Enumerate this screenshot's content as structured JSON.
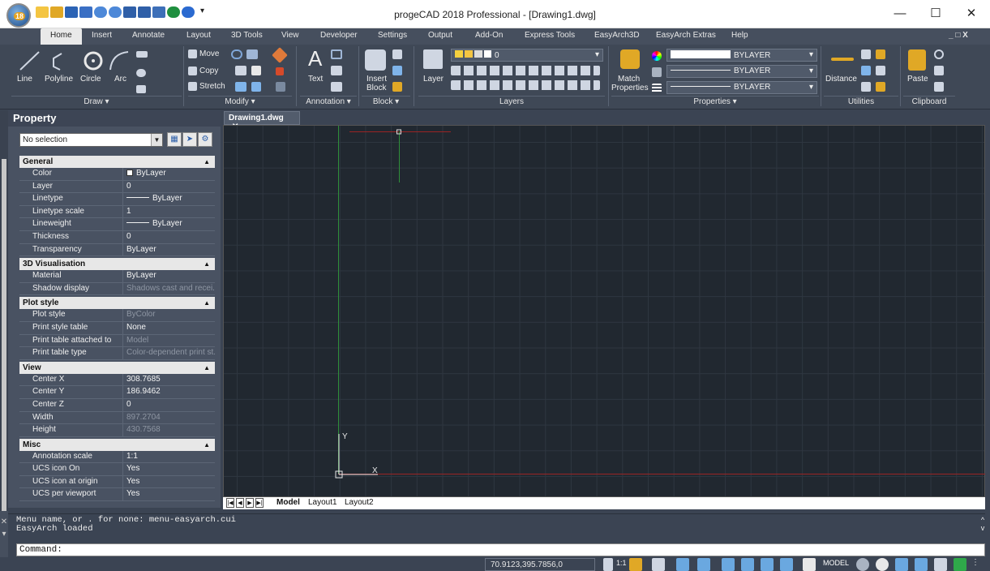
{
  "window": {
    "title": "progeCAD 2018 Professional - [Drawing1.dwg]",
    "app_badge": "18"
  },
  "menu_tabs": [
    "Home",
    "Insert",
    "Annotate",
    "Layout",
    "3D Tools",
    "View",
    "Developer",
    "Settings",
    "Output",
    "Add-On",
    "Express Tools",
    "EasyArch3D",
    "EasyArch Extras",
    "Help"
  ],
  "ribbon": {
    "draw": {
      "line": "Line",
      "polyline": "Polyline",
      "circle": "Circle",
      "arc": "Arc",
      "group": "Draw ▾"
    },
    "modify": {
      "move": "Move",
      "copy": "Copy",
      "stretch": "Stretch",
      "group": "Modify ▾"
    },
    "annotation": {
      "text": "Text",
      "group": "Annotation ▾"
    },
    "block": {
      "insert": "Insert",
      "insert2": "Block",
      "group": "Block ▾"
    },
    "layers": {
      "layer": "Layer",
      "current": "0",
      "group": "Layers"
    },
    "properties": {
      "match": "Match",
      "match2": "Properties",
      "color": "BYLAYER",
      "linetype": "BYLAYER",
      "lineweight": "BYLAYER",
      "group": "Properties ▾"
    },
    "utilities": {
      "distance": "Distance",
      "group": "Utilities"
    },
    "clipboard": {
      "paste": "Paste",
      "group": "Clipboard"
    }
  },
  "property_panel": {
    "title": "Property",
    "selection": "No selection",
    "sections": [
      {
        "name": "General",
        "rows": [
          {
            "key": "Color",
            "value": "ByLayer"
          },
          {
            "key": "Layer",
            "value": "0"
          },
          {
            "key": "Linetype",
            "value": "ByLayer"
          },
          {
            "key": "Linetype scale",
            "value": "1"
          },
          {
            "key": "Lineweight",
            "value": "ByLayer"
          },
          {
            "key": "Thickness",
            "value": "0"
          },
          {
            "key": "Transparency",
            "value": "ByLayer"
          }
        ]
      },
      {
        "name": "3D Visualisation",
        "rows": [
          {
            "key": "Material",
            "value": "ByLayer"
          },
          {
            "key": "Shadow display",
            "value": "Shadows cast and recei..."
          }
        ]
      },
      {
        "name": "Plot style",
        "rows": [
          {
            "key": "Plot style",
            "value": "ByColor"
          },
          {
            "key": "Print style table",
            "value": "None"
          },
          {
            "key": "Print table attached to",
            "value": "Model"
          },
          {
            "key": "Print table type",
            "value": "Color-dependent print st..."
          }
        ]
      },
      {
        "name": "View",
        "rows": [
          {
            "key": "Center X",
            "value": "308.7685"
          },
          {
            "key": "Center Y",
            "value": "186.9462"
          },
          {
            "key": "Center Z",
            "value": "0"
          },
          {
            "key": "Width",
            "value": "897.2704"
          },
          {
            "key": "Height",
            "value": "430.7568"
          }
        ]
      },
      {
        "name": "Misc",
        "rows": [
          {
            "key": "Annotation scale",
            "value": "1:1"
          },
          {
            "key": "UCS icon On",
            "value": "Yes"
          },
          {
            "key": "UCS icon at origin",
            "value": "Yes"
          },
          {
            "key": "UCS per viewport",
            "value": "Yes"
          }
        ]
      }
    ]
  },
  "doc_tab": "Drawing1.dwg",
  "ucs": {
    "x": "X",
    "y": "Y"
  },
  "layout_tabs": [
    "Model",
    "Layout1",
    "Layout2"
  ],
  "command": {
    "history_1": "Menu name, or . for none: menu-easyarch.cui",
    "history_2": "EasyArch loaded",
    "prompt": "Command:"
  },
  "status": {
    "coords": "70.9123,395.7856,0",
    "scale": "1:1",
    "model": "MODEL"
  }
}
